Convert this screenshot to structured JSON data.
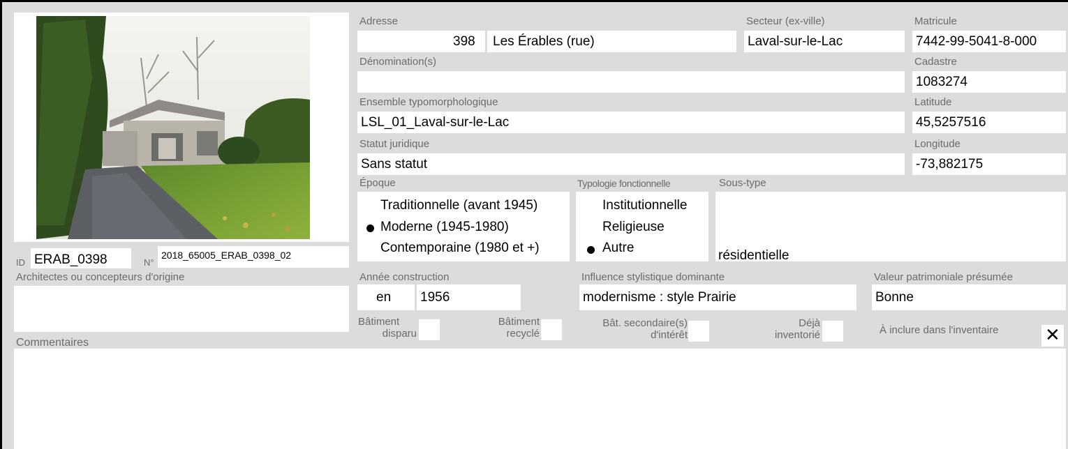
{
  "labels": {
    "adresse": "Adresse",
    "secteur": "Secteur (ex-ville)",
    "matricule": "Matricule",
    "denomination": "Dénomination(s)",
    "cadastre": "Cadastre",
    "ensemble": "Ensemble typomorphologique",
    "latitude": "Latitude",
    "statut": "Statut juridique",
    "longitude": "Longitude",
    "epoque": "Époque",
    "typologie": "Typologie fonctionnelle",
    "soustype": "Sous-type",
    "id": "ID",
    "no": "N°",
    "architectes": "Architectes ou concepteurs d'origine",
    "annee": "Année construction",
    "influence": "Influence stylistique dominante",
    "valeur": "Valeur patrimoniale présumée",
    "commentaires": "Commentaires",
    "batiment_disparu": [
      "Bâtiment",
      "disparu"
    ],
    "batiment_recycle": [
      "Bâtiment",
      "recyclé"
    ],
    "bat_secondaire": [
      "Bât. secondaire(s)",
      "d'intérêt"
    ],
    "deja_inventorie": [
      "Déjà",
      "inventorié"
    ],
    "a_inclure": "À inclure dans l'inventaire"
  },
  "values": {
    "adresse_numero": "398",
    "adresse_rue": "Les Érables (rue)",
    "secteur": "Laval-sur-le-Lac",
    "matricule": "7442-99-5041-8-000",
    "denomination": "",
    "cadastre": "1083274",
    "ensemble": "LSL_01_Laval-sur-le-Lac",
    "latitude": "45,5257516",
    "statut": "Sans statut",
    "longitude": "-73,882175",
    "soustype": "résidentielle",
    "id": "ERAB_0398",
    "no": "2018_65005_ERAB_0398_02",
    "architectes": "",
    "annee_prefix": "en",
    "annee": "1956",
    "influence": "modernisme : style Prairie",
    "valeur": "Bonne",
    "commentaires": "",
    "a_inclure_mark": "✕"
  },
  "epoque_options": [
    {
      "label": "Traditionnelle (avant 1945)",
      "selected": false
    },
    {
      "label": "Moderne (1945-1980)",
      "selected": true
    },
    {
      "label": "Contemporaine (1980 et +)",
      "selected": false
    }
  ],
  "typologie_options": [
    {
      "label": "Institutionnelle",
      "selected": false
    },
    {
      "label": "Religieuse",
      "selected": false
    },
    {
      "label": "Autre",
      "selected": true
    }
  ],
  "checkboxes": {
    "batiment_disparu": false,
    "batiment_recycle": false,
    "bat_secondaire": false,
    "deja_inventorie": false,
    "a_inclure": true
  }
}
